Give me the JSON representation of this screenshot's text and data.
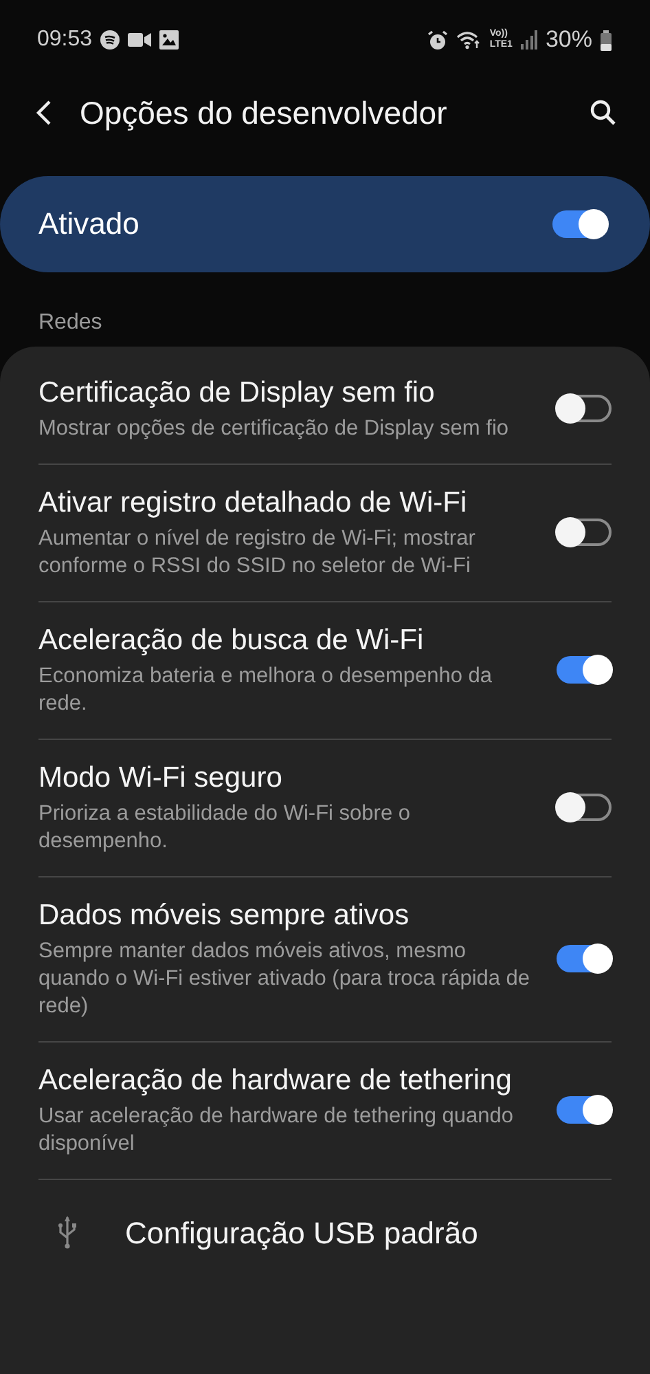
{
  "status_bar": {
    "time": "09:53",
    "network_label": "Vo))",
    "network_type": "LTE1",
    "battery": "30%"
  },
  "header": {
    "title": "Opções do desenvolvedor"
  },
  "master_switch": {
    "label": "Ativado",
    "on": true
  },
  "section": {
    "title": "Redes"
  },
  "settings": [
    {
      "kind": "toggle",
      "title": "Certificação de Display sem fio",
      "summary": "Mostrar opções de certificação de Display sem fio",
      "on": false
    },
    {
      "kind": "toggle",
      "title": "Ativar registro detalhado de Wi-Fi",
      "summary": "Aumentar o nível de registro de Wi-Fi; mostrar conforme o RSSI do SSID no seletor de Wi-Fi",
      "on": false
    },
    {
      "kind": "toggle",
      "title": "Aceleração de busca de Wi-Fi",
      "summary": "Economiza bateria e melhora o desempenho da rede.",
      "on": true
    },
    {
      "kind": "toggle",
      "title": "Modo Wi-Fi seguro",
      "summary": "Prioriza a estabilidade do Wi-Fi sobre o desempenho.",
      "on": false
    },
    {
      "kind": "toggle",
      "title": "Dados móveis sempre ativos",
      "summary": "Sempre manter dados móveis ativos, mesmo quando o Wi-Fi estiver ativado (para troca rápida de rede)",
      "on": true
    },
    {
      "kind": "toggle",
      "title": "Aceleração de hardware de tethering",
      "summary": "Usar aceleração de hardware de tethering quando disponível",
      "on": true
    },
    {
      "kind": "link",
      "title": "Configuração USB padrão"
    }
  ]
}
